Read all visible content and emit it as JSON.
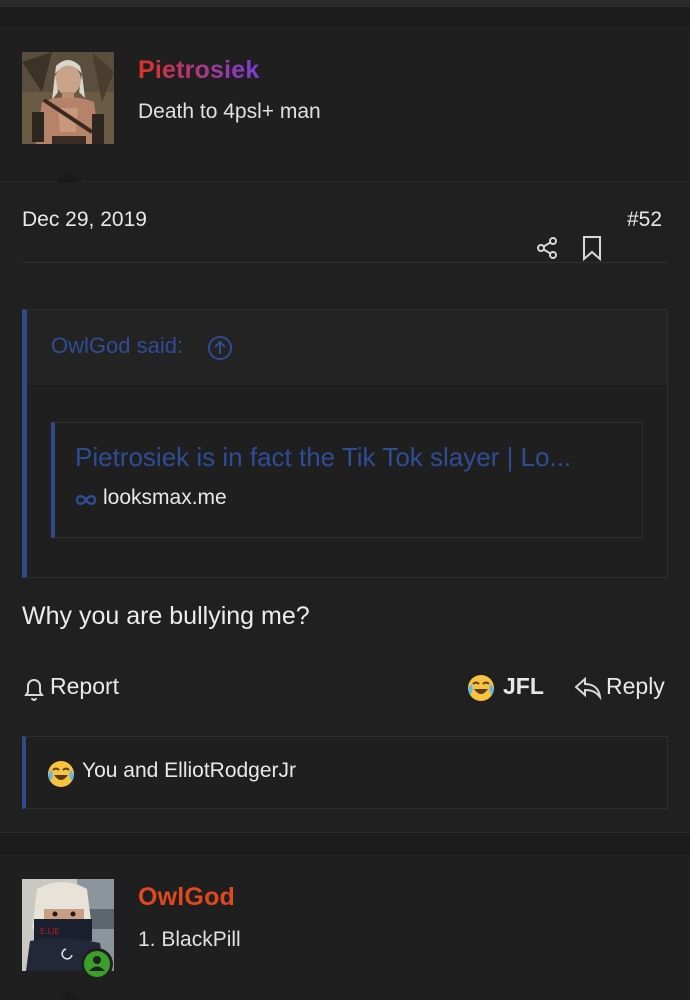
{
  "posts": [
    {
      "username": "Pietrosiek",
      "user_title": "Death to 4psl+ man",
      "date": "Dec 29, 2019",
      "post_number": "#52",
      "quote": {
        "author": "OwlGod said:",
        "unfurl_title": "Pietrosiek is in fact the Tik Tok slayer | Lo...",
        "unfurl_domain": "looksmax.me"
      },
      "body": "Why you are bullying me?",
      "actions": {
        "report": "Report",
        "reaction": "JFL",
        "reply": "Reply"
      },
      "reactions_text": "You and ElliotRodgerJr"
    },
    {
      "username": "OwlGod",
      "user_title": "1. BlackPill"
    }
  ],
  "colors": {
    "accent_blue": "#2f4a8a",
    "username_gradient": [
      "#e0312a",
      "#7b3ddb"
    ],
    "owlgod_color": "#e0481e",
    "online_green": "#3aa02a"
  },
  "icons": [
    "share-icon",
    "bookmark-icon",
    "arrow-up-circle-icon",
    "link-icon",
    "bell-icon",
    "crying-laughing-emoji-icon",
    "reply-icon",
    "online-user-icon"
  ]
}
